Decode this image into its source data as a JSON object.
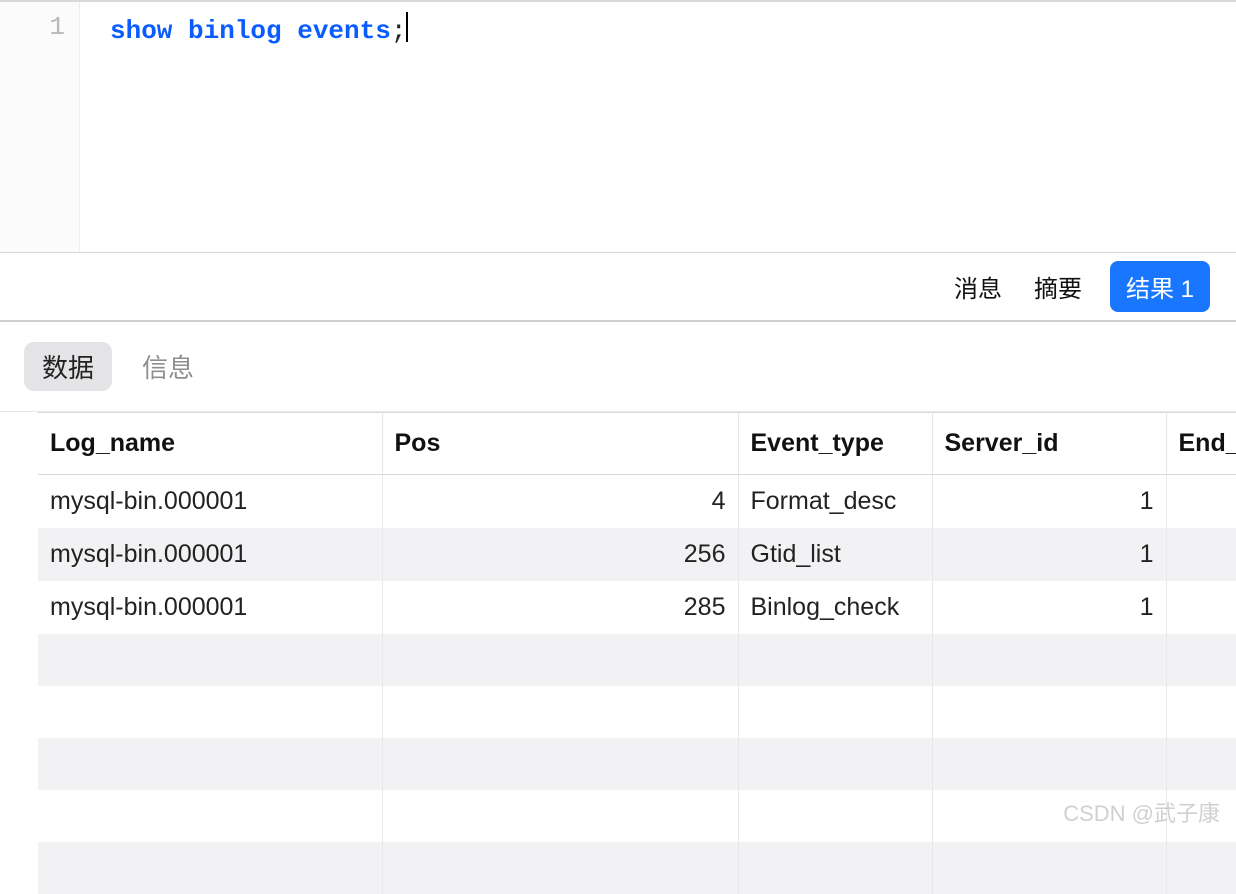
{
  "editor": {
    "line_number": "1",
    "sql_keywords": "show binlog events",
    "sql_terminator": ";"
  },
  "output_tabs": {
    "messages": "消息",
    "summary": "摘要",
    "result": "结果 1"
  },
  "subtabs": {
    "data": "数据",
    "info": "信息"
  },
  "table": {
    "columns": {
      "log_name": "Log_name",
      "pos": "Pos",
      "event_type": "Event_type",
      "server_id": "Server_id",
      "end_log_pos": "End_"
    },
    "rows": [
      {
        "log_name": "mysql-bin.000001",
        "pos": "4",
        "event_type": "Format_desc",
        "server_id": "1",
        "end_log_pos": ""
      },
      {
        "log_name": "mysql-bin.000001",
        "pos": "256",
        "event_type": "Gtid_list",
        "server_id": "1",
        "end_log_pos": ""
      },
      {
        "log_name": "mysql-bin.000001",
        "pos": "285",
        "event_type": "Binlog_check",
        "server_id": "1",
        "end_log_pos": ""
      },
      {
        "log_name": "",
        "pos": "",
        "event_type": "",
        "server_id": "",
        "end_log_pos": ""
      },
      {
        "log_name": "",
        "pos": "",
        "event_type": "",
        "server_id": "",
        "end_log_pos": ""
      },
      {
        "log_name": "",
        "pos": "",
        "event_type": "",
        "server_id": "",
        "end_log_pos": ""
      },
      {
        "log_name": "",
        "pos": "",
        "event_type": "",
        "server_id": "",
        "end_log_pos": ""
      },
      {
        "log_name": "",
        "pos": "",
        "event_type": "",
        "server_id": "",
        "end_log_pos": ""
      }
    ]
  },
  "watermark": "CSDN @武子康"
}
